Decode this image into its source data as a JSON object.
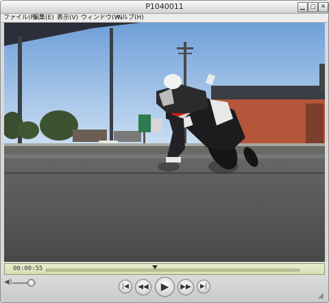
{
  "window": {
    "title": "P1040011"
  },
  "menu": [
    {
      "label": "ファイル(F)"
    },
    {
      "label": "編集(E)"
    },
    {
      "label": "表示(V)"
    },
    {
      "label": "ウィンドウ(W)"
    },
    {
      "label": "ヘルプ(H)"
    }
  ],
  "video": {
    "description_icon": "video-frame"
  },
  "controls": {
    "time": "00:00:55",
    "progress": 0.43,
    "volume": 0.8
  },
  "icons": {
    "minimize": "minimize-icon",
    "maximize": "maximize-icon",
    "close": "close-icon"
  }
}
